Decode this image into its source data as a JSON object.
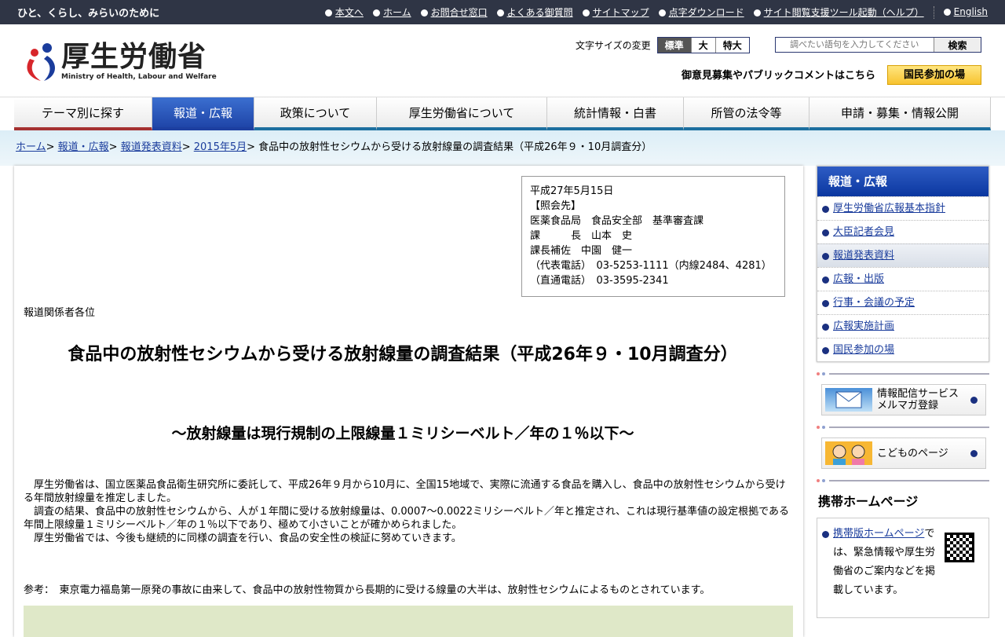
{
  "topbar": {
    "tagline": "ひと、くらし、みらいのために",
    "links": [
      "本文へ",
      "ホーム",
      "お問合せ窓口",
      "よくある御質問",
      "サイトマップ",
      "点字ダウンロード",
      "サイト閲覧支援ツール起動（ヘルプ）"
    ],
    "english": "English"
  },
  "header": {
    "logo_name": "厚生労働省",
    "logo_sub": "Ministry of Health, Labour and Welfare",
    "font_size_label": "文字サイズの変更",
    "font_sizes": [
      "標準",
      "大",
      "特大"
    ],
    "search_placeholder": "調べたい語句を入力してください",
    "search_button": "検索",
    "public_comment": "御意見募集やパブリックコメントはこちら",
    "kokumin_button": "国民参加の場"
  },
  "nav": [
    "テーマ別に探す",
    "報道・広報",
    "政策について",
    "厚生労働省について",
    "統計情報・白書",
    "所管の法令等",
    "申請・募集・情報公開"
  ],
  "breadcrumb": {
    "links": [
      "ホーム",
      "報道・広報",
      "報道発表資料",
      "2015年5月"
    ],
    "current": "食品中の放射性セシウムから受ける放射線量の調査結果（平成26年９・10月調査分）"
  },
  "contact": "平成27年5月15日\n【照会先】\n医薬食品局　食品安全部　基準審査課\n課　　　長　山本　史\n課長補佐　中園　健一\n（代表電話）　03-5253-1111（内線2484、4281）\n（直通電話）　03-3595-2341",
  "article": {
    "to": "報道関係者各位",
    "title": "食品中の放射性セシウムから受ける放射線量の調査結果（平成26年９・10月調査分）",
    "subtitle": "～放射線量は現行規制の上限線量１ミリシーベルト／年の１％以下～",
    "paragraphs": [
      "　厚生労働省は、国立医薬品食品衛生研究所に委託して、平成26年９月から10月に、全国15地域で、実際に流通する食品を購入し、食品中の放射性セシウムから受ける年間放射線量を推定しました。",
      "　調査の結果、食品中の放射性セシウムから、人が１年間に受ける放射線量は、0.0007～0.0022ミリシーベルト／年と推定され、これは現行基準値の設定根拠である年間上限線量１ミリシーベルト／年の１％以下であり、極めて小さいことが確かめられました。",
      "　厚生労働省では、今後も継続的に同様の調査を行い、食品の安全性の検証に努めていきます。"
    ],
    "reference": "参考：　東京電力福島第一原発の事故に由来して、食品中の放射性物質から長期的に受ける線量の大半は、放射性セシウムによるものとされています。"
  },
  "sidebar": {
    "heading": "報道・広報",
    "items": [
      "厚生労働省広報基本指針",
      "大臣記者会見",
      "報道発表資料",
      "広報・出版",
      "行事・会議の予定",
      "広報実施計画",
      "国民参加の場"
    ],
    "mail_banner": [
      "情報配信サービス",
      "メルマガ登録"
    ],
    "kids_banner": "こどものページ",
    "mobile_heading": "携帯ホームページ",
    "mobile_link": "携帯版ホームページ",
    "mobile_text": "では、緊急情報や厚生労働省のご案内などを掲載しています。"
  }
}
